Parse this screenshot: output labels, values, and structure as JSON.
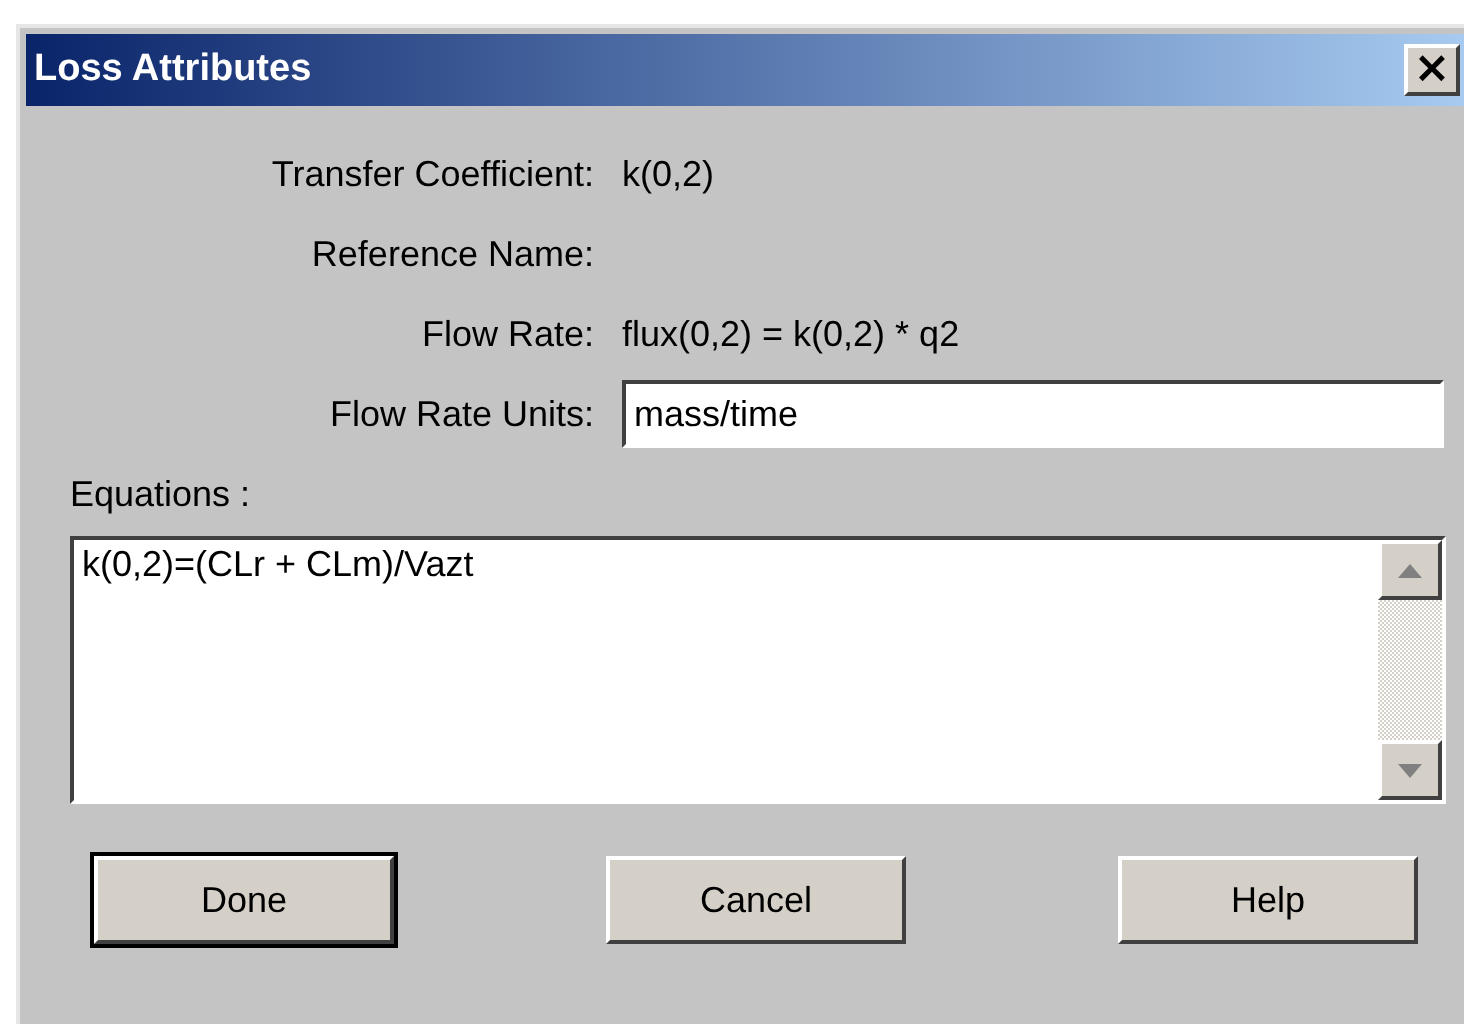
{
  "window": {
    "title": "Loss Attributes",
    "close": "×"
  },
  "fields": [
    {
      "kind": "text",
      "label": "Transfer Coefficient:",
      "value": "k(0,2)"
    },
    {
      "kind": "text",
      "label": "Reference Name:"
    },
    {
      "kind": "text",
      "label": "Flow Rate:",
      "value": "flux(0,2) = k(0,2) * q2"
    },
    {
      "kind": "input",
      "label": "Flow Rate Units:",
      "value": "mass/time"
    }
  ],
  "equations": {
    "label": "Equations :",
    "value": "k(0,2)=(CLr + CLm)/Vazt"
  },
  "buttons": [
    {
      "label": "Done",
      "default": true
    },
    {
      "label": "Cancel",
      "default": false
    },
    {
      "label": "Help",
      "default": false
    }
  ]
}
